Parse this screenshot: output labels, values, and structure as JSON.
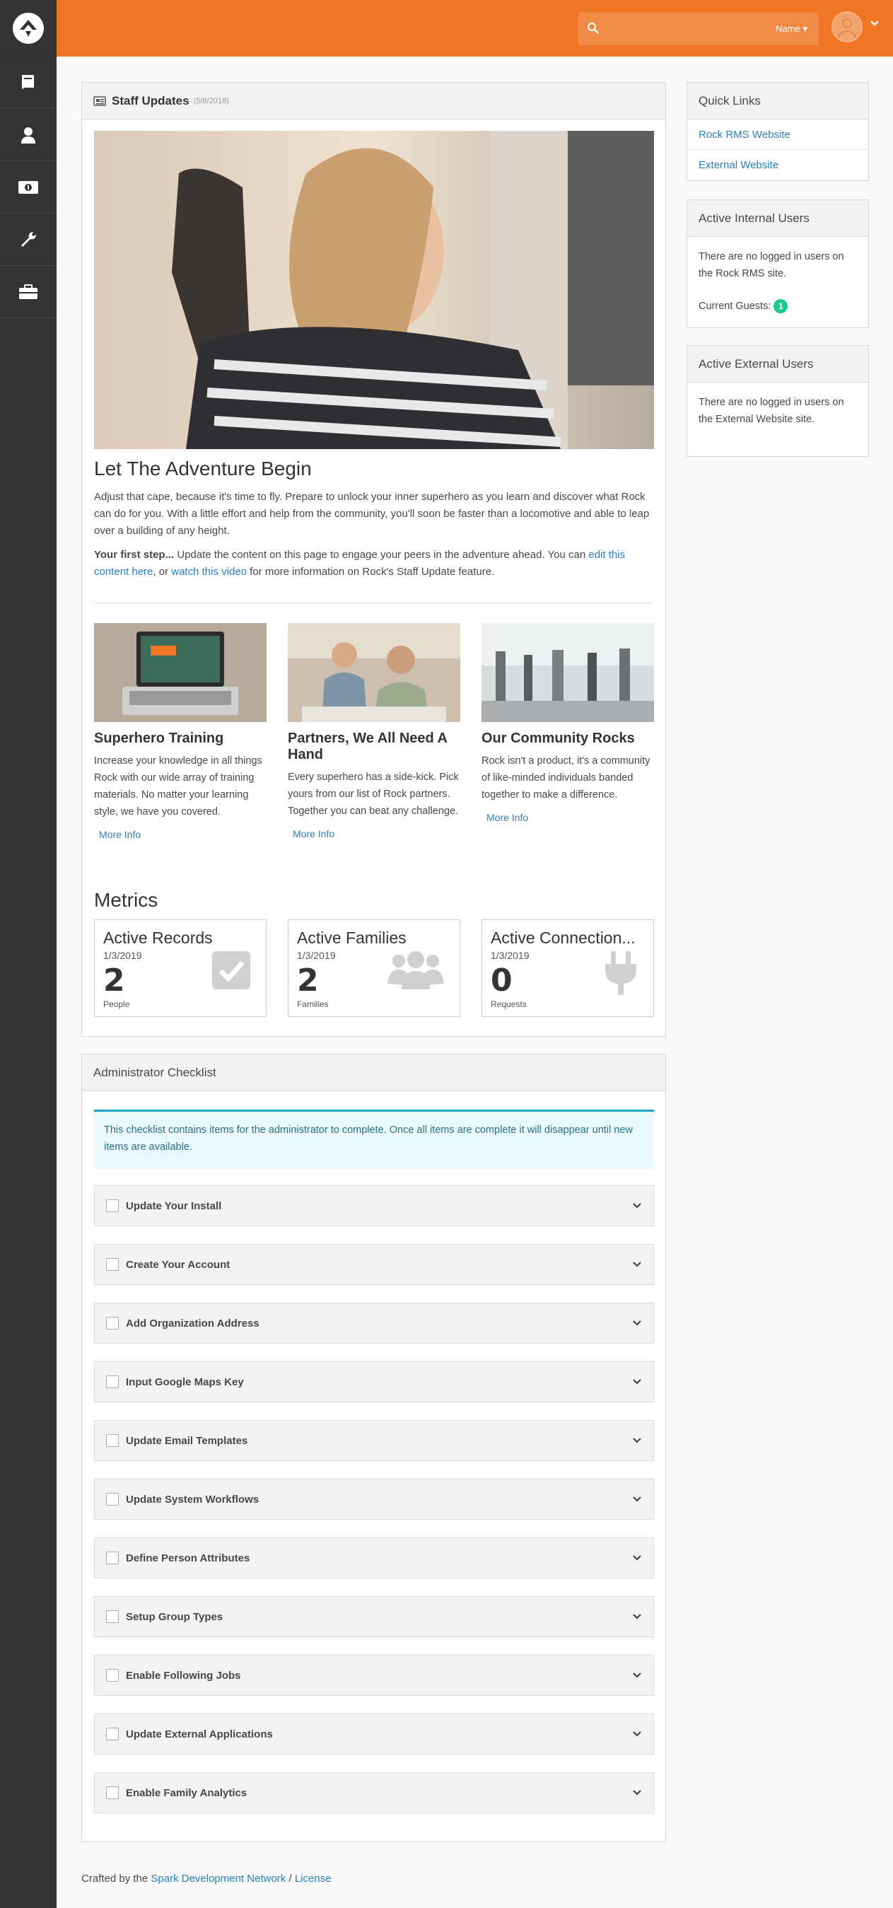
{
  "header": {
    "search_placeholder": "",
    "search_filter_label": "Name ▾"
  },
  "sidebar": {
    "items": [
      {
        "icon": "book-icon"
      },
      {
        "icon": "user-icon"
      },
      {
        "icon": "money-icon"
      },
      {
        "icon": "wrench-icon"
      },
      {
        "icon": "briefcase-icon"
      }
    ]
  },
  "staff_updates": {
    "title": "Staff Updates",
    "date": "(5/8/2018)",
    "article_title": "Let The Adventure Begin",
    "intro": "Adjust that cape, because it's time to fly. Prepare to unlock your inner superhero as you learn and discover what Rock can do for you. With a little effort and help from the community, you'll soon be faster than a locomotive and able to leap over a building of any height.",
    "first_step_label": "Your first step...",
    "first_step_text_1": " Update the content on this page to engage your peers in the adventure ahead. You can ",
    "link_edit": "edit this content here",
    "first_step_text_2": ", or ",
    "link_video": "watch this video",
    "first_step_text_3": " for more information on Rock's Staff Update feature.",
    "cards": [
      {
        "title": "Superhero Training",
        "text": "Increase your knowledge in all things Rock with our wide array of training materials. No matter your learning style, we have you covered.",
        "link": "More Info"
      },
      {
        "title": "Partners, We All Need A Hand",
        "text": "Every superhero has a side-kick. Pick yours from our list of Rock partners. Together you can beat any challenge.",
        "link": "More Info"
      },
      {
        "title": "Our Community Rocks",
        "text": "Rock isn't a product, it's a community of like-minded individuals banded together to make a difference.",
        "link": "More Info"
      }
    ],
    "metrics_title": "Metrics",
    "metrics": [
      {
        "title": "Active Records",
        "date": "1/3/2019",
        "value": "2",
        "unit": "People",
        "icon": "check-square-icon"
      },
      {
        "title": "Active Families",
        "date": "1/3/2019",
        "value": "2",
        "unit": "Families",
        "icon": "users-icon"
      },
      {
        "title": "Active Connection...",
        "date": "1/3/2019",
        "value": "0",
        "unit": "Requests",
        "icon": "plug-icon"
      }
    ]
  },
  "quick_links": {
    "title": "Quick Links",
    "items": [
      "Rock RMS Website",
      "External Website"
    ]
  },
  "internal_users": {
    "title": "Active Internal Users",
    "message": "There are no logged in users on the Rock RMS site.",
    "guests_label": "Current Guests:",
    "guests_count": "1"
  },
  "external_users": {
    "title": "Active External Users",
    "message": "There are no logged in users on the External Website site."
  },
  "checklist": {
    "title": "Administrator Checklist",
    "alert": "This checklist contains items for the administrator to complete. Once all items are complete it will disappear until new items are available.",
    "items": [
      "Update Your Install",
      "Create Your Account",
      "Add Organization Address",
      "Input Google Maps Key",
      "Update Email Templates",
      "Update System Workflows",
      "Define Person Attributes",
      "Setup Group Types",
      "Enable Following Jobs",
      "Update External Applications",
      "Enable Family Analytics"
    ]
  },
  "footer": {
    "prefix": "Crafted by the ",
    "link1": "Spark Development Network",
    "sep": " / ",
    "link2": "License"
  },
  "colors": {
    "brand_orange": "#ee7625",
    "sidebar": "#333333",
    "link": "#2a7fbf",
    "badge": "#16c98d"
  }
}
